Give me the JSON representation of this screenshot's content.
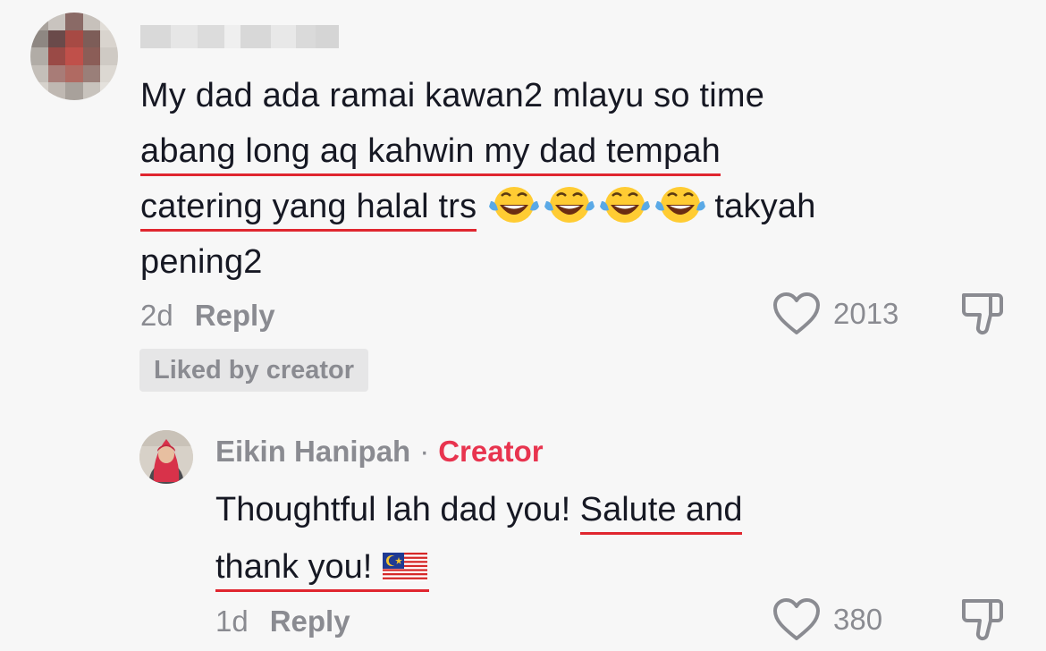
{
  "comment": {
    "text": {
      "line1": "My dad ada ramai kawan2 mlayu so time",
      "line2": "abang long aq kahwin my dad tempah",
      "line3": "catering yang halal trs",
      "line3_tail": "takyah",
      "line4": "pening2"
    },
    "emoji_icon": "face-with-tears-of-joy-icon",
    "emoji_count": 4,
    "time": "2d",
    "reply_label": "Reply",
    "likes": "2013",
    "liked_badge": "Liked by creator"
  },
  "reply": {
    "author": "Eikin Hanipah",
    "separator": "·",
    "role": "Creator",
    "text": {
      "part1": "Thoughtful lah dad you!",
      "part2": "Salute and",
      "part3": "thank you!"
    },
    "flag_icon": "malaysia-flag-icon",
    "time": "1d",
    "reply_label": "Reply",
    "likes": "380"
  },
  "colors": {
    "background": "#f7f7f7",
    "text": "#161823",
    "meta": "#8a8b91",
    "creator": "#e8344f",
    "underline": "#e0262f",
    "badge_bg": "#e6e6e7"
  }
}
